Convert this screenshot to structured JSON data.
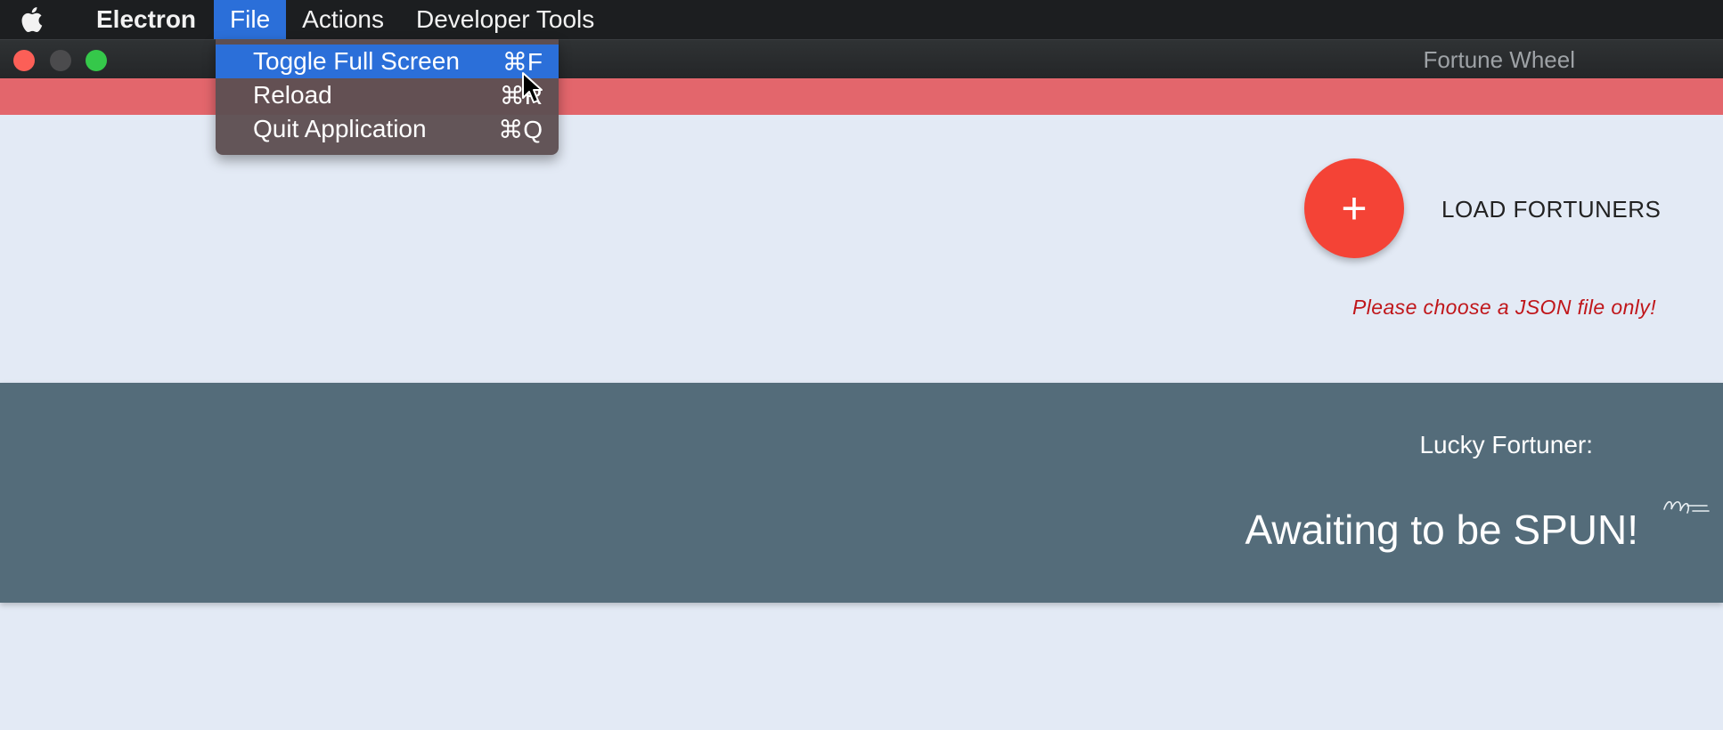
{
  "menubar": {
    "app_name": "Electron",
    "items": [
      "File",
      "Actions",
      "Developer Tools"
    ],
    "active_item": "File"
  },
  "window": {
    "title": "Fortune Wheel"
  },
  "file_menu": {
    "items": [
      {
        "label": "Toggle Full Screen",
        "shortcut": "⌘F",
        "highlighted": true
      },
      {
        "label": "Reload",
        "shortcut": "⌘R"
      },
      {
        "label": "Quit Application",
        "shortcut": "⌘Q"
      }
    ]
  },
  "load": {
    "button_symbol": "+",
    "label": "LOAD FORTUNERS",
    "warning": "Please choose a JSON file only!"
  },
  "result": {
    "label": "Lucky Fortuner:",
    "value": "Awaiting to be SPUN!"
  },
  "colors": {
    "header_band": "#e3666c",
    "fab": "#f44336",
    "result_band": "#546c7a",
    "menu_highlight": "#2b6fd9",
    "background": "#e3eaf5"
  },
  "icons": [
    "apple-icon",
    "plus-icon",
    "mouse-cursor-icon",
    "scribble-icon"
  ]
}
